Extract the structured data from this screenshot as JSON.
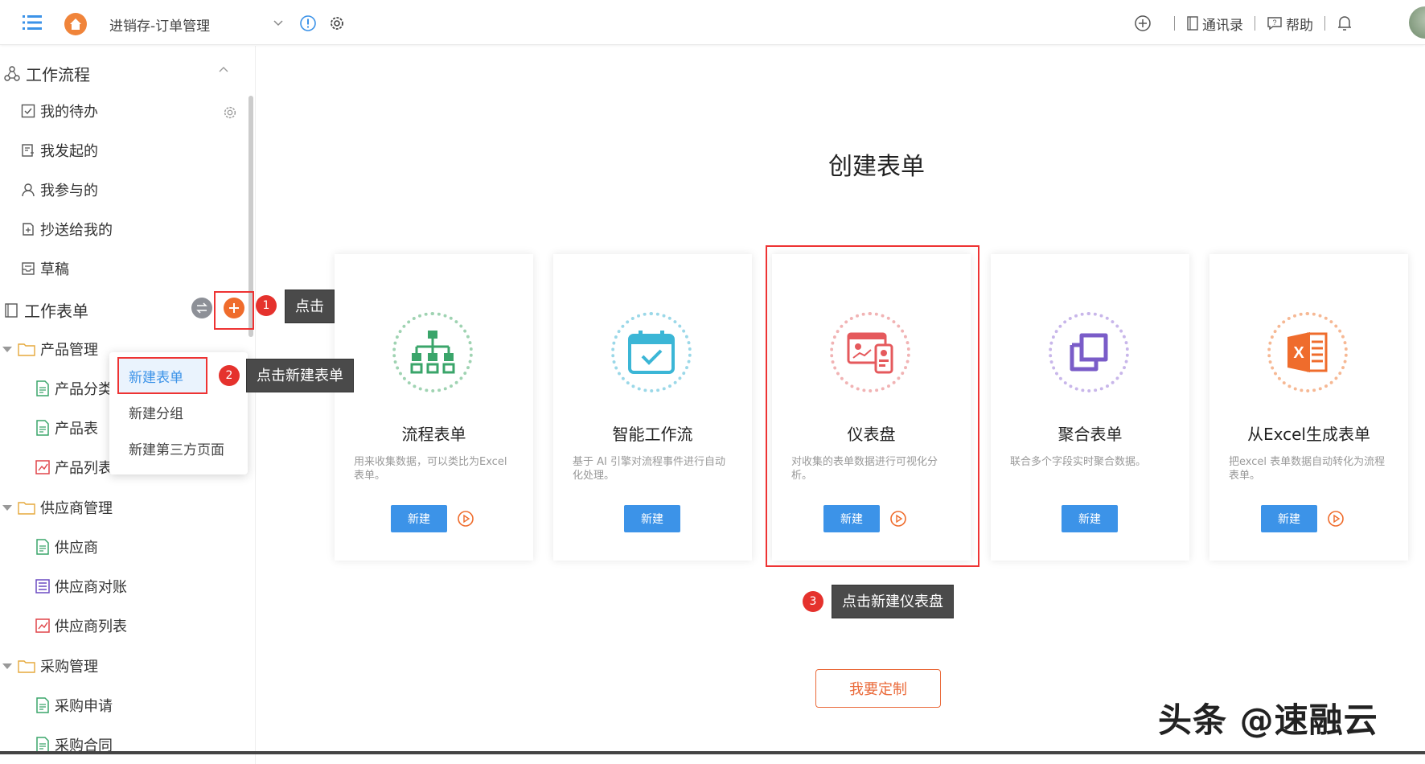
{
  "topbar": {
    "app_title": "进销存-订单管理",
    "right_links": [
      "通讯录",
      "帮助"
    ]
  },
  "sidebar": {
    "workflow_section": "工作流程",
    "workflow_items": [
      "我的待办",
      "我发起的",
      "我参与的",
      "抄送给我的",
      "草稿"
    ],
    "forms_section": "工作表单",
    "groups": [
      {
        "name": "产品管理",
        "items": [
          "产品分类",
          "产品表",
          "产品列表"
        ]
      },
      {
        "name": "供应商管理",
        "items": [
          "供应商",
          "供应商对账",
          "供应商列表"
        ]
      },
      {
        "name": "采购管理",
        "items": [
          "采购申请",
          "采购合同"
        ]
      }
    ]
  },
  "popup_menu": [
    "新建表单",
    "新建分组",
    "新建第三方页面"
  ],
  "annotations": [
    {
      "num": "1",
      "text": "点击"
    },
    {
      "num": "2",
      "text": "点击新建表单"
    },
    {
      "num": "3",
      "text": "点击新建仪表盘"
    }
  ],
  "main": {
    "title": "创建表单",
    "cards": [
      {
        "name": "流程表单",
        "desc": "用来收集数据，可以类比为Excel 表单。",
        "button": "新建",
        "color": "#4caf7d"
      },
      {
        "name": "智能工作流",
        "desc": "基于 AI 引擎对流程事件进行自动化处理。",
        "button": "新建",
        "color": "#3bb6d6"
      },
      {
        "name": "仪表盘",
        "desc": "对收集的表单数据进行可视化分析。",
        "button": "新建",
        "color": "#e5595c"
      },
      {
        "name": "聚合表单",
        "desc": "联合多个字段实时聚合数据。",
        "button": "新建",
        "color": "#7a5cc8"
      },
      {
        "name": "从Excel生成表单",
        "desc": "把excel 表单数据自动转化为流程表单。",
        "button": "新建",
        "color": "#ef6c2c"
      }
    ],
    "custom_button": "我要定制"
  },
  "watermark": "头条 @速融云"
}
